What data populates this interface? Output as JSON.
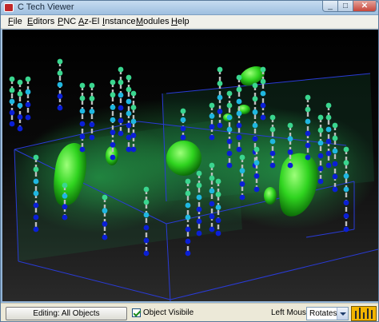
{
  "window": {
    "title": "C Tech Viewer"
  },
  "menu": [
    {
      "id": "file",
      "acc": "F",
      "rest": "ile"
    },
    {
      "id": "editors",
      "acc": "E",
      "rest": "ditors"
    },
    {
      "id": "pnc",
      "acc": "P",
      "rest": "NC"
    },
    {
      "id": "az-el",
      "acc": "A",
      "rest": "z-El"
    },
    {
      "id": "instance",
      "acc": "I",
      "rest": "nstance"
    },
    {
      "id": "modules",
      "acc": "M",
      "rest": "odules"
    },
    {
      "id": "help",
      "acc": "H",
      "rest": "elp"
    }
  ],
  "status": {
    "editing_label": "Editing: All Objects",
    "object_visible_label": "Object Visibile",
    "object_visible_checked": true,
    "left_mouse_label": "Left Mouse",
    "left_mouse_value": "Rotates"
  },
  "colors": {
    "plume": "#39d62c",
    "bore_low": "#0a1fd6",
    "bore_mid": "#1fb7e0",
    "bore_high": "#3ad68f",
    "box_lines": "#2a3bd6"
  }
}
